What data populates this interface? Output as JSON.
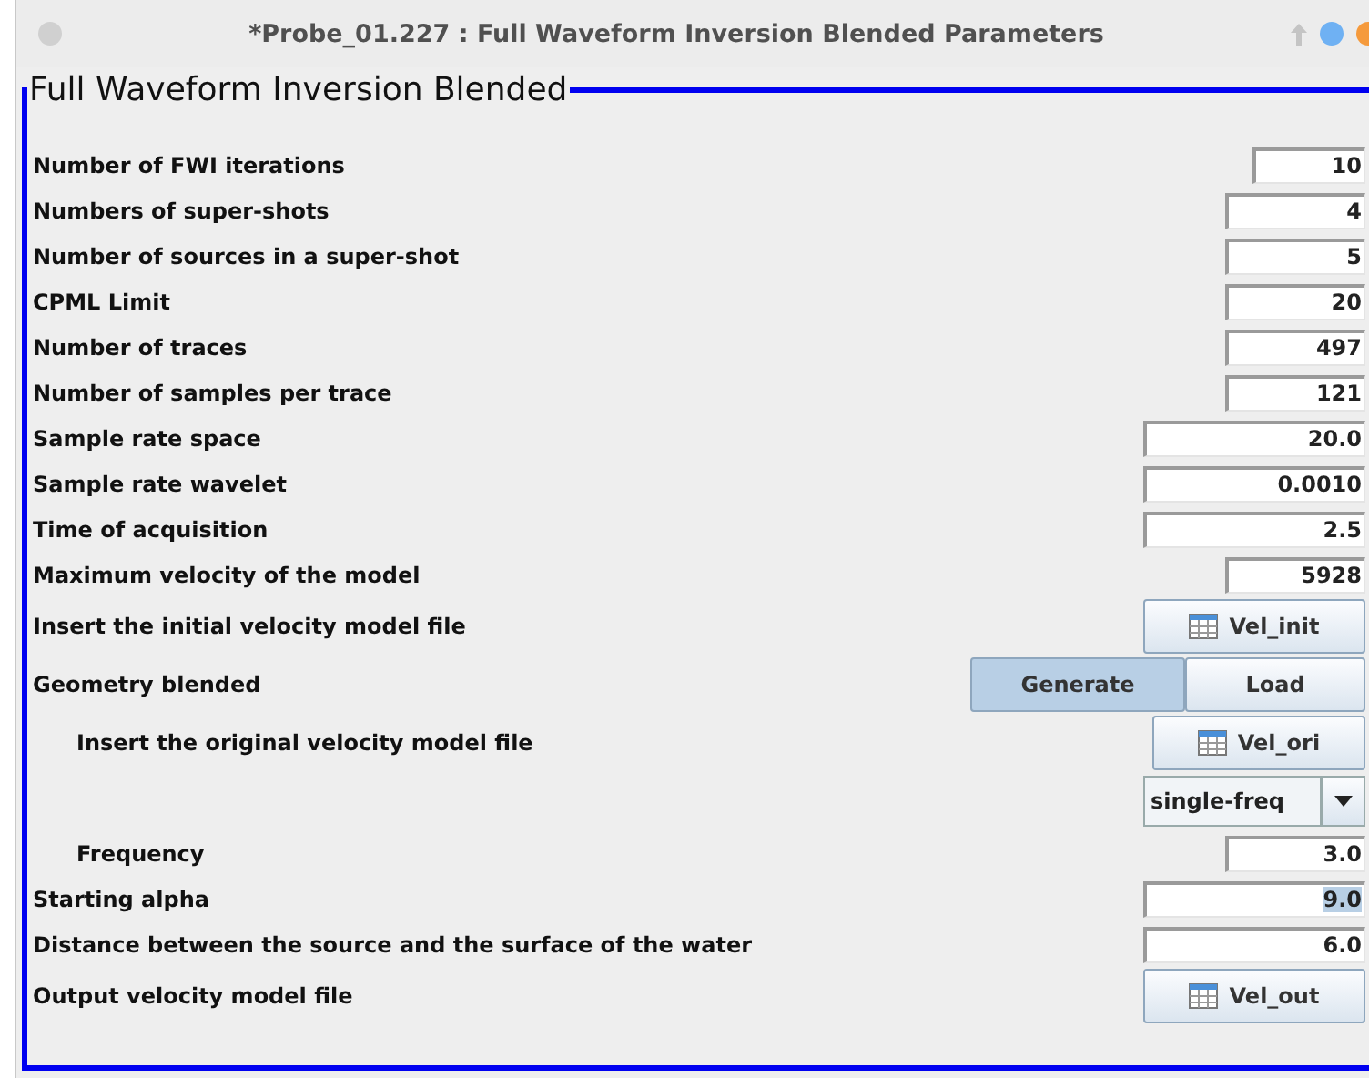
{
  "window": {
    "title": "*Probe_01.227 : Full Waveform Inversion Blended Parameters"
  },
  "panel": {
    "title": "Full Waveform Inversion Blended"
  },
  "rows": [
    {
      "kind": "field-narrow",
      "label": "Number of FWI iterations",
      "value": "10",
      "highlighted": false
    },
    {
      "kind": "field",
      "label": "Numbers of super-shots",
      "value": "4",
      "highlighted": false
    },
    {
      "kind": "field",
      "label": "Number of sources in a super-shot",
      "value": "5",
      "highlighted": false
    },
    {
      "kind": "field",
      "label": "CPML Limit",
      "value": "20",
      "highlighted": false
    },
    {
      "kind": "field",
      "label": "Number of traces",
      "value": "497",
      "highlighted": false
    },
    {
      "kind": "field",
      "label": "Number of samples per trace",
      "value": "121",
      "highlighted": false
    },
    {
      "kind": "field-wide",
      "label": "Sample rate space",
      "value": "20.0",
      "highlighted": false
    },
    {
      "kind": "field-wide",
      "label": "Sample rate wavelet",
      "value": "0.0010",
      "highlighted": false
    },
    {
      "kind": "field-wide",
      "label": "Time of acquisition",
      "value": "2.5",
      "highlighted": false
    },
    {
      "kind": "field",
      "label": "Maximum velocity of the model",
      "value": "5928",
      "highlighted": false
    },
    {
      "kind": "file",
      "label": "Insert the initial velocity model file",
      "button": "Vel_init"
    },
    {
      "kind": "toggle",
      "label": "Geometry blended",
      "options": [
        {
          "label": "Generate",
          "selected": true
        },
        {
          "label": "Load",
          "selected": false
        }
      ]
    },
    {
      "kind": "file",
      "label": "Insert the original velocity model file",
      "indented": true,
      "button": "Vel_ori"
    },
    {
      "kind": "combo",
      "value": "single-freq"
    },
    {
      "kind": "field",
      "label": "Frequency",
      "indented": true,
      "value": "3.0",
      "highlighted": false
    },
    {
      "kind": "field-wide",
      "label": "Starting alpha",
      "value": "9.0",
      "highlighted": true
    },
    {
      "kind": "field-wide",
      "label": "Distance between the source and the surface of the water",
      "value": "6.0",
      "highlighted": false
    },
    {
      "kind": "file",
      "label": "Output velocity model file",
      "button": "Vel_out"
    }
  ]
}
